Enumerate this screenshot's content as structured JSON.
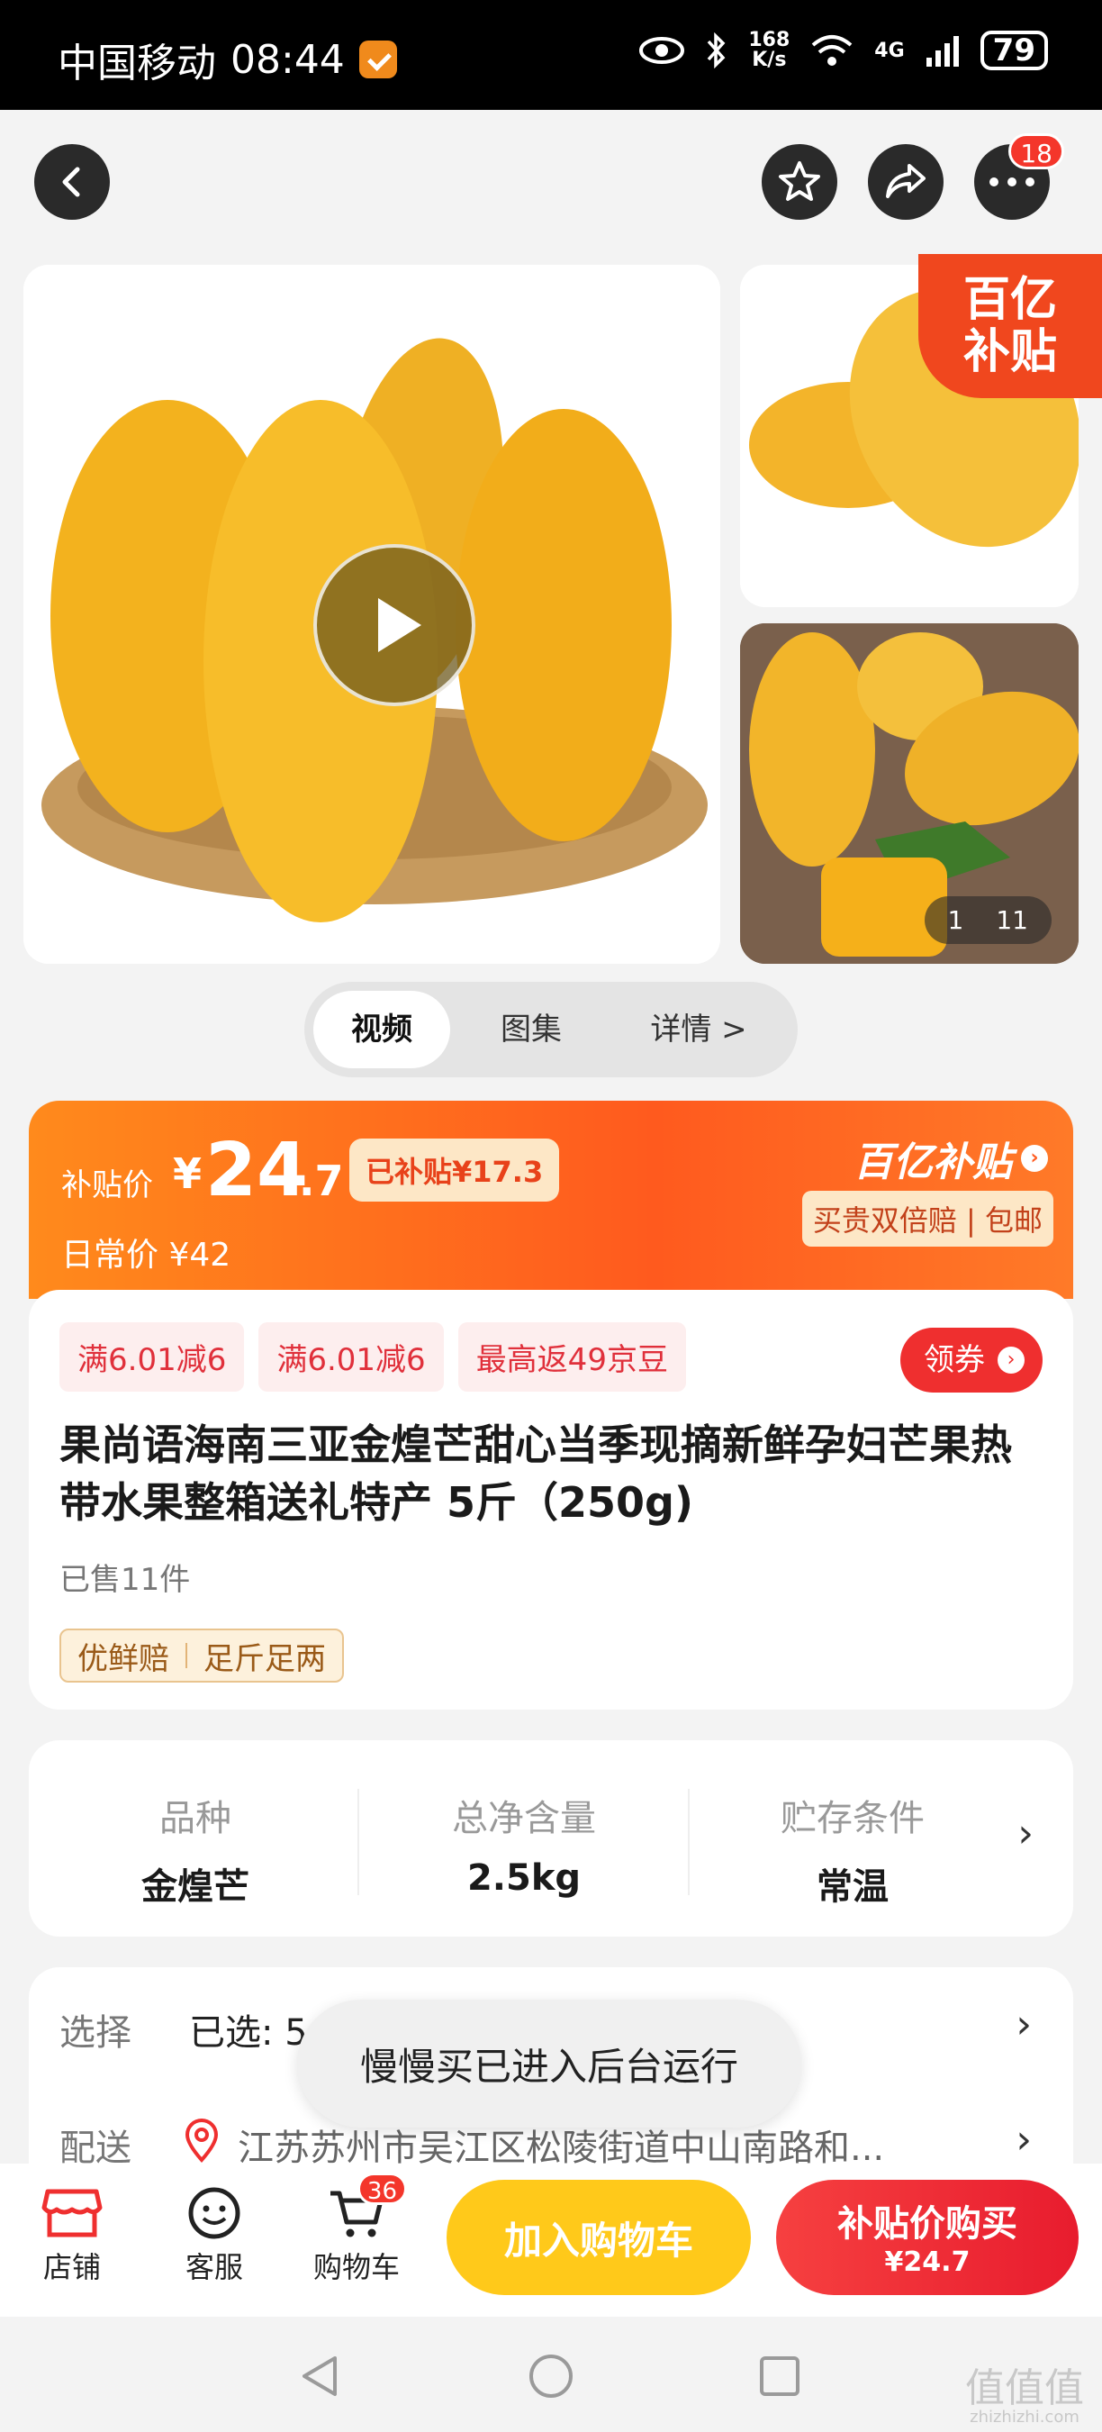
{
  "status_bar": {
    "carrier": "中国移动",
    "time": "08:44",
    "speed_value": "168",
    "speed_unit": "K/s",
    "network": "4G",
    "battery": "79"
  },
  "top_nav": {
    "more_badge": "18"
  },
  "gallery": {
    "subsidy_corner_line1": "百亿",
    "subsidy_corner_line2": "补贴",
    "counter_current": "1",
    "counter_total": "11"
  },
  "media_tabs": [
    "视频",
    "图集",
    "详情 >"
  ],
  "price": {
    "subsidy_label": "补贴价",
    "currency": "¥",
    "integer": "24",
    "decimal": ".7",
    "subsidized": "已补贴¥17.3",
    "regular": "日常价 ¥42",
    "brand": "百亿补贴",
    "guarantee": "买贵双倍赔 | 包邮"
  },
  "coupons": [
    "满6.01减6",
    "满6.01减6",
    "最高返49京豆"
  ],
  "get_coupon_label": "领券",
  "product": {
    "title": "果尚语海南三亚金煌芒甜心当季现摘新鲜孕妇芒果热带水果整箱送礼特产 5斤（250g)",
    "sold": "已售11件",
    "tags": [
      "优鲜赔",
      "足斤足两"
    ]
  },
  "specs": [
    {
      "key": "品种",
      "value": "金煌芒"
    },
    {
      "key": "总净含量",
      "value": "2.5kg"
    },
    {
      "key": "贮存条件",
      "value": "常温"
    }
  ],
  "options": {
    "select_label": "选择",
    "select_value": "已选: 5",
    "delivery_label": "配送",
    "delivery_address": "江苏苏州市吴江区松陵街道中山南路和..."
  },
  "toast": "慢慢买已进入后台运行",
  "bottom_bar": {
    "shop": "店铺",
    "service": "客服",
    "cart": "购物车",
    "cart_badge": "36",
    "add_to_cart": "加入购物车",
    "buy_label": "补贴价购买",
    "buy_price": "¥24.7"
  },
  "watermark": {
    "main": "值值值",
    "sub": "zhizhizhi.com"
  },
  "colors": {
    "accent_red": "#ef2f2f",
    "accent_orange": "#ff5a1e",
    "cart_yellow": "#ffc91a"
  }
}
